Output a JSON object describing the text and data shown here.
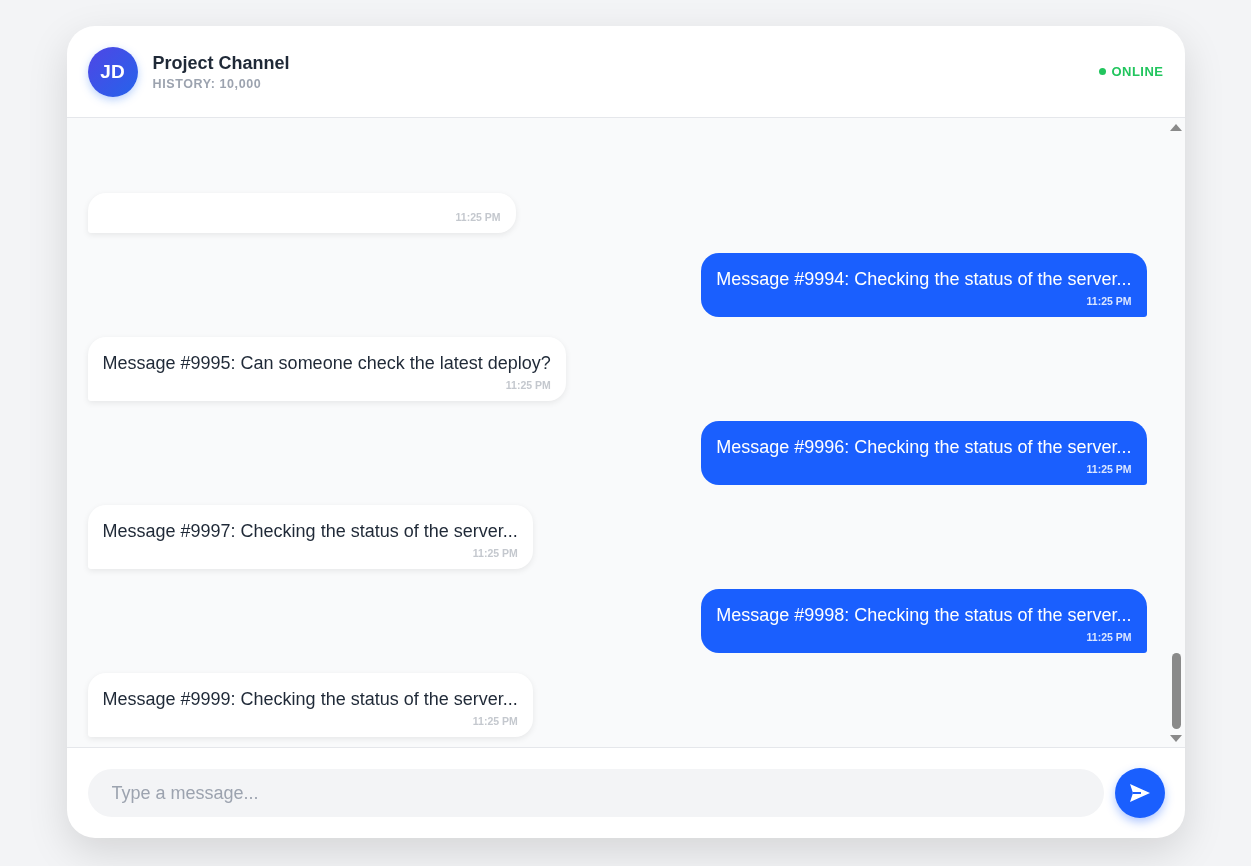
{
  "header": {
    "avatar": "JD",
    "title": "Project Channel",
    "subtitle": "HISTORY: 10,000",
    "status": {
      "label": "ONLINE",
      "online": true
    }
  },
  "messages": [
    {
      "kind": "incoming",
      "time": "11:25 PM"
    },
    {
      "kind": "outgoing",
      "text": "Message #9994: Checking the status of the server...",
      "time": "11:25 PM"
    },
    {
      "kind": "incoming",
      "text": "Message #9995: Can someone check the latest deploy?",
      "time": "11:25 PM"
    },
    {
      "kind": "outgoing",
      "text": "Message #9996: Checking the status of the server...",
      "time": "11:25 PM"
    },
    {
      "kind": "incoming",
      "text": "Message #9997: Checking the status of the server...",
      "time": "11:25 PM"
    },
    {
      "kind": "outgoing",
      "text": "Message #9998: Checking the status of the server...",
      "time": "11:25 PM"
    },
    {
      "kind": "incoming",
      "text": "Message #9999: Checking the status of the server...",
      "time": "11:25 PM"
    }
  ],
  "composer": {
    "placeholder": "Type a message..."
  }
}
